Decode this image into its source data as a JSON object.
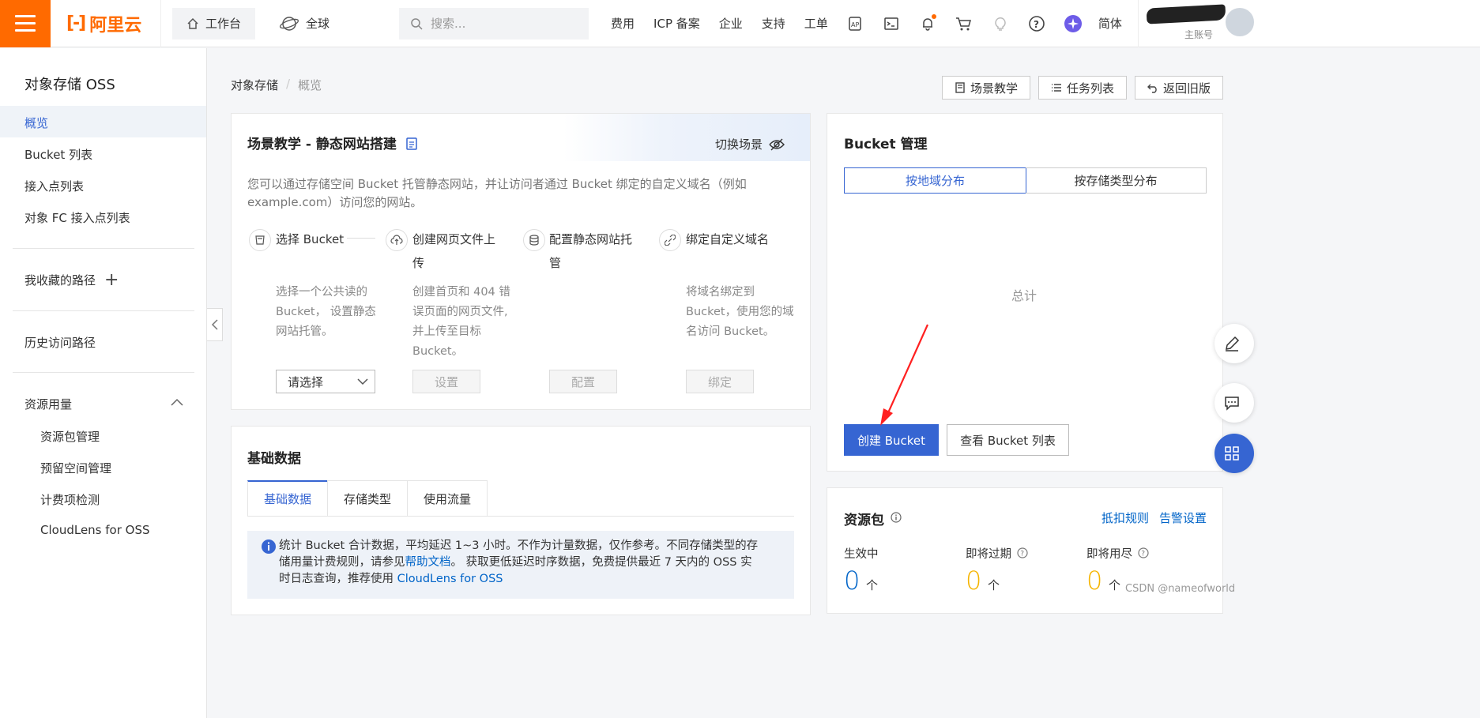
{
  "topbar": {
    "logo_text": "阿里云",
    "workbench": "工作台",
    "global": "全球",
    "search_placeholder": "搜索...",
    "links": [
      "费用",
      "ICP 备案",
      "企业",
      "支持",
      "工单"
    ],
    "language": "简体",
    "account_label": "主账号"
  },
  "sidebar": {
    "title": "对象存储 OSS",
    "items": [
      "概览",
      "Bucket 列表",
      "接入点列表",
      "对象 FC 接入点列表"
    ],
    "favorites": "我收藏的路径",
    "history": "历史访问路径",
    "usage": "资源用量",
    "usage_items": [
      "资源包管理",
      "预留空间管理",
      "计费项检测",
      "CloudLens for OSS"
    ]
  },
  "breadcrumb": {
    "root": "对象存储",
    "sep": "/",
    "current": "概览"
  },
  "header_buttons": {
    "scene": "场景教学",
    "tasks": "任务列表",
    "old": "返回旧版"
  },
  "scene": {
    "title": "场景教学 - 静态网站搭建",
    "switch": "切换场景",
    "desc_line1": "您可以通过存储空间 Bucket 托管静态网站，并让访问者通过 Bucket 绑定的自定义域名（例如",
    "desc_line2": "example.com）访问您的网站。",
    "steps": [
      {
        "title1": "选择 Bucket",
        "title2": "",
        "desc": [
          "选择一个公共读的",
          "Bucket， 设置静态",
          "网站托管。"
        ],
        "action": "请选择"
      },
      {
        "title1": "创建网页文件上",
        "title2": "传",
        "desc": [
          "创建首页和 404 错",
          "误页面的网页文件,",
          "并上传至目标",
          "Bucket。"
        ],
        "action": "设置"
      },
      {
        "title1": "配置静态网站托",
        "title2": "管",
        "desc": [],
        "action": "配置"
      },
      {
        "title1": "绑定自定义域名",
        "title2": "",
        "desc": [
          "将域名绑定到",
          "Bucket，使用您的域",
          "名访问 Bucket。"
        ],
        "action": "绑定"
      }
    ]
  },
  "basic": {
    "title": "基础数据",
    "tabs": [
      "基础数据",
      "存储类型",
      "使用流量"
    ],
    "notice_1": "统计 Bucket 合计数据，平均延迟 1~3 小时。不作为计量数据，仅作参考。不同存储类型的存",
    "notice_2a": "储用量计费规则，请参见",
    "notice_link1": "帮助文档",
    "notice_2b": "。 获取更低延迟时序数据，免费提供最近 7 天内的 OSS 实",
    "notice_3a": "时日志查询，推荐使用 ",
    "notice_link2": "CloudLens for OSS"
  },
  "bucket": {
    "title": "Bucket 管理",
    "tabs": [
      "按地域分布",
      "按存储类型分布"
    ],
    "total": "总计",
    "create": "创建 Bucket",
    "view_list": "查看 Bucket 列表"
  },
  "resource": {
    "title": "资源包",
    "rule": "抵扣规则",
    "alert": "告警设置",
    "stats": [
      {
        "label": "生效中",
        "value": "0",
        "unit": "个",
        "color": "#0064c8"
      },
      {
        "label": "即将过期",
        "value": "0",
        "unit": "个",
        "color": "#f5b400"
      },
      {
        "label": "即将用尽",
        "value": "0",
        "unit": "个",
        "color": "#f5b400"
      }
    ]
  },
  "watermark": "CSDN @nameofworld",
  "colors": {
    "accent": "#ff6a00",
    "primary": "#3665d2",
    "link": "#0064c8",
    "annotation": "#ff2020"
  }
}
